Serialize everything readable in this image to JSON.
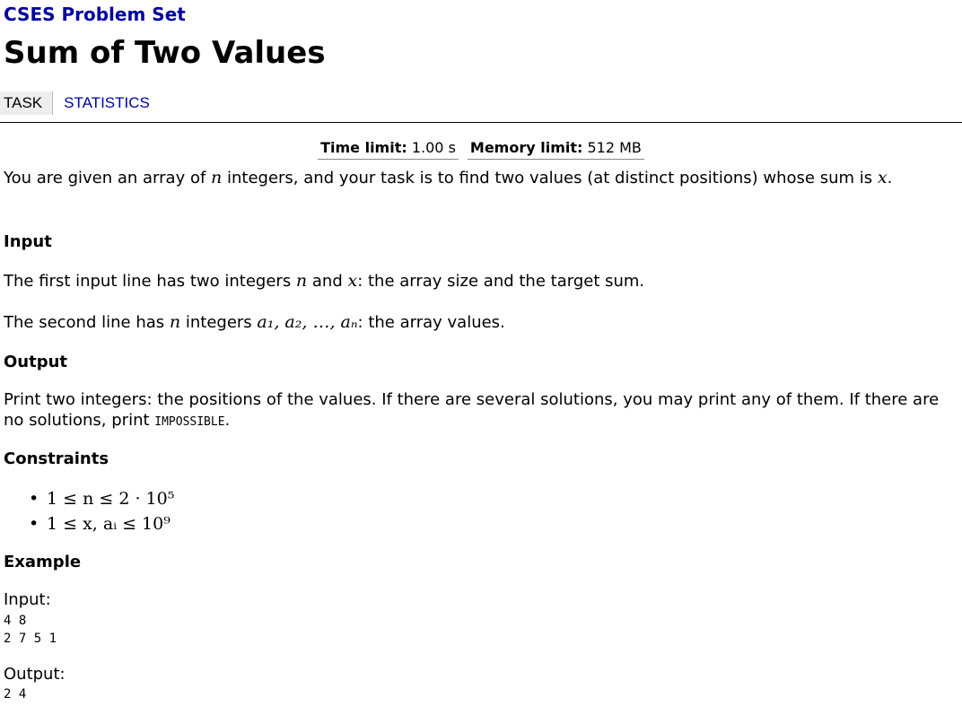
{
  "site": {
    "title": "CSES Problem Set"
  },
  "problem": {
    "title": "Sum of Two Values"
  },
  "nav": {
    "tabs": [
      {
        "label": "TASK",
        "active": true
      },
      {
        "label": "STATISTICS",
        "active": false
      }
    ]
  },
  "limits": {
    "time_label": "Time limit:",
    "time_value": "1.00 s",
    "memory_label": "Memory limit:",
    "memory_value": "512 MB"
  },
  "statement": {
    "intro_1": "You are given an array of ",
    "intro_var_n": "n",
    "intro_2": " integers, and your task is to find two values (at distinct positions) whose sum is ",
    "intro_var_x": "x",
    "intro_3": "."
  },
  "input_section": {
    "heading": "Input",
    "line1_a": "The first input line has two integers ",
    "line1_n": "n",
    "line1_b": " and ",
    "line1_x": "x",
    "line1_c": ": the array size and the target sum.",
    "line2_a": "The second line has ",
    "line2_n": "n",
    "line2_b": " integers ",
    "line2_seq": "a₁, a₂, …, aₙ",
    "line2_c": ": the array values."
  },
  "output_section": {
    "heading": "Output",
    "text_a": "Print two integers: the positions of the values. If there are several solutions, you may print any of them. If there are no solutions, print ",
    "impossible": "IMPOSSIBLE",
    "text_b": "."
  },
  "constraints_section": {
    "heading": "Constraints",
    "items": [
      "1 ≤ n ≤ 2 · 10⁵",
      "1 ≤ x, aᵢ ≤ 10⁹"
    ]
  },
  "example_section": {
    "heading": "Example",
    "input_label": "Input:",
    "input_lines": "4 8\n2 7 5 1",
    "output_label": "Output:",
    "output_lines": "2 4"
  }
}
